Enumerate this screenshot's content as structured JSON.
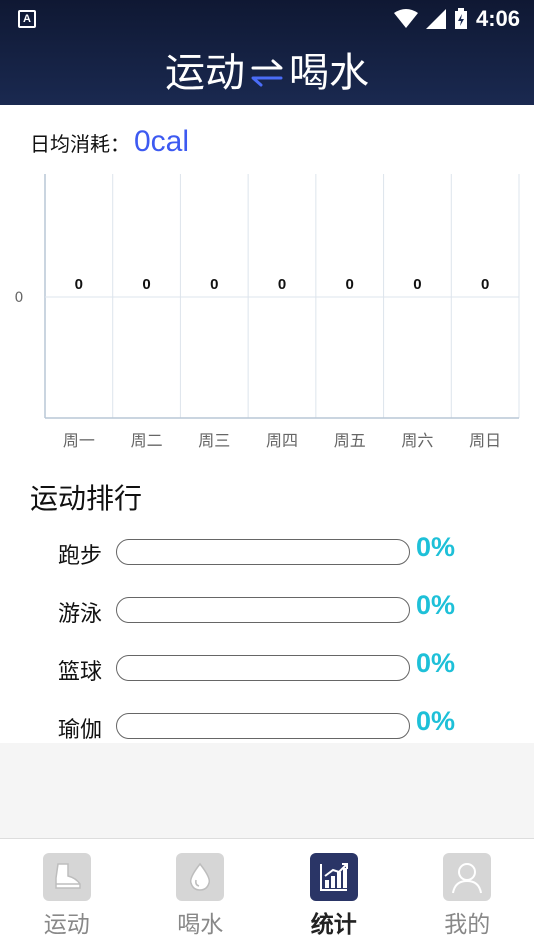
{
  "status": {
    "time": "4:06",
    "left_icon": "A"
  },
  "header": {
    "title_left": "运动",
    "title_right": "喝水"
  },
  "summary": {
    "label": "日均消耗：",
    "value": "0cal"
  },
  "chart_data": {
    "type": "bar",
    "categories": [
      "周一",
      "周二",
      "周三",
      "周四",
      "周五",
      "周六",
      "周日"
    ],
    "values": [
      0,
      0,
      0,
      0,
      0,
      0,
      0
    ],
    "ytick_labels": [
      "0"
    ],
    "ylim": [
      0,
      0
    ],
    "grid": true
  },
  "ranking": {
    "title": "运动排行",
    "items": [
      {
        "label": "跑步",
        "percent": "0%",
        "fraction": 0
      },
      {
        "label": "游泳",
        "percent": "0%",
        "fraction": 0
      },
      {
        "label": "篮球",
        "percent": "0%",
        "fraction": 0
      },
      {
        "label": "瑜伽",
        "percent": "0%",
        "fraction": 0
      }
    ]
  },
  "nav": {
    "items": [
      {
        "label": "运动",
        "icon": "shoe-icon",
        "active": false
      },
      {
        "label": "喝水",
        "icon": "water-drop-icon",
        "active": false
      },
      {
        "label": "统计",
        "icon": "chart-icon",
        "active": true
      },
      {
        "label": "我的",
        "icon": "user-icon",
        "active": false
      }
    ]
  },
  "colors": {
    "accent": "#3d5af1",
    "percent": "#1ec0d8",
    "header": "#1a2950",
    "nav_active": "#2a3566"
  }
}
